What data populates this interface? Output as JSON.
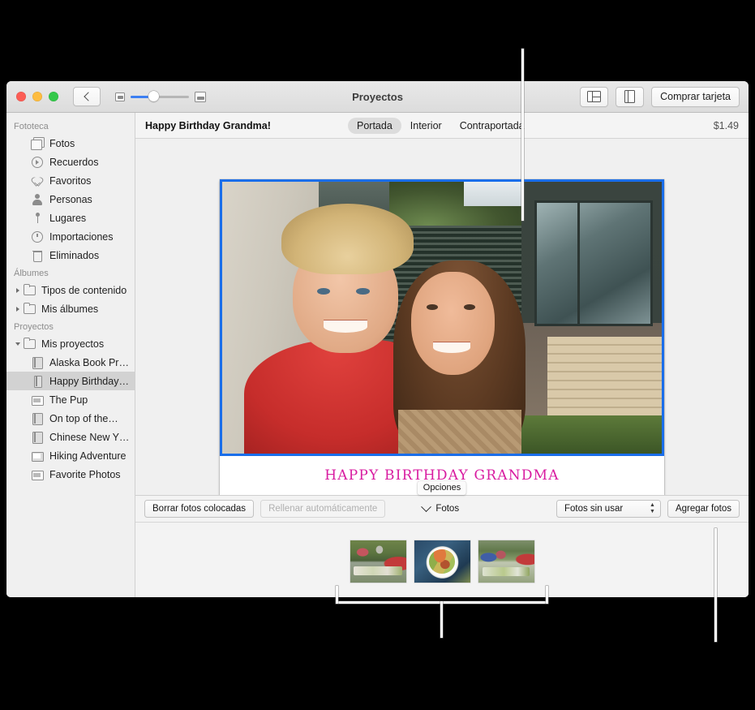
{
  "window": {
    "title": "Proyectos",
    "traffic_lights": [
      "close",
      "minimize",
      "zoom"
    ],
    "back_label": "Volver",
    "buy_button": "Comprar tarjeta"
  },
  "sidebar": {
    "sections": [
      {
        "header": "Fototeca",
        "items": [
          {
            "label": "Fotos",
            "icon": "photos-icon"
          },
          {
            "label": "Recuerdos",
            "icon": "memories-icon"
          },
          {
            "label": "Favoritos",
            "icon": "heart-icon"
          },
          {
            "label": "Personas",
            "icon": "person-icon"
          },
          {
            "label": "Lugares",
            "icon": "pin-icon"
          },
          {
            "label": "Importaciones",
            "icon": "clock-icon"
          },
          {
            "label": "Eliminados",
            "icon": "trash-icon"
          }
        ]
      },
      {
        "header": "Álbumes",
        "items": [
          {
            "label": "Tipos de contenido",
            "icon": "folder-icon"
          },
          {
            "label": "Mis álbumes",
            "icon": "folder-icon"
          }
        ]
      },
      {
        "header": "Proyectos",
        "items": [
          {
            "label": "Mis proyectos",
            "icon": "folder-icon"
          },
          {
            "label": "Alaska Book Pr…",
            "icon": "book-icon"
          },
          {
            "label": "Happy Birthday…",
            "icon": "card-icon"
          },
          {
            "label": "The Pup",
            "icon": "print-icon"
          },
          {
            "label": "On top of the…",
            "icon": "book-icon"
          },
          {
            "label": "Chinese New Y…",
            "icon": "book-icon"
          },
          {
            "label": "Hiking Adventure",
            "icon": "slideshow-icon"
          },
          {
            "label": "Favorite Photos",
            "icon": "print-icon"
          }
        ]
      }
    ]
  },
  "content_header": {
    "project_name": "Happy Birthday Grandma!",
    "tabs": [
      {
        "label": "Portada",
        "active": true
      },
      {
        "label": "Interior",
        "active": false
      },
      {
        "label": "Contraportada",
        "active": false
      }
    ],
    "price": "$1.49"
  },
  "card": {
    "caption": "HAPPY BIRTHDAY GRANDMA",
    "caption_color": "#d81ba0",
    "selection_color": "#1a6eea",
    "photo_alt": "Abuela y nieta sonriendo abrazadas al aire libre"
  },
  "options_tooltip": "Opciones",
  "bottom_toolbar": {
    "clear_photos": "Borrar fotos colocadas",
    "autofill": "Rellenar automáticamente",
    "photos_disclosure": "Fotos",
    "filter_popup": "Fotos sin usar",
    "add_photos": "Agregar fotos"
  },
  "tray": {
    "thumbnails": [
      {
        "alt": "Familia cenando en el jardín"
      },
      {
        "alt": "Plato de salmón con verduras"
      },
      {
        "alt": "Grupo en la mesa del jardín"
      }
    ]
  }
}
